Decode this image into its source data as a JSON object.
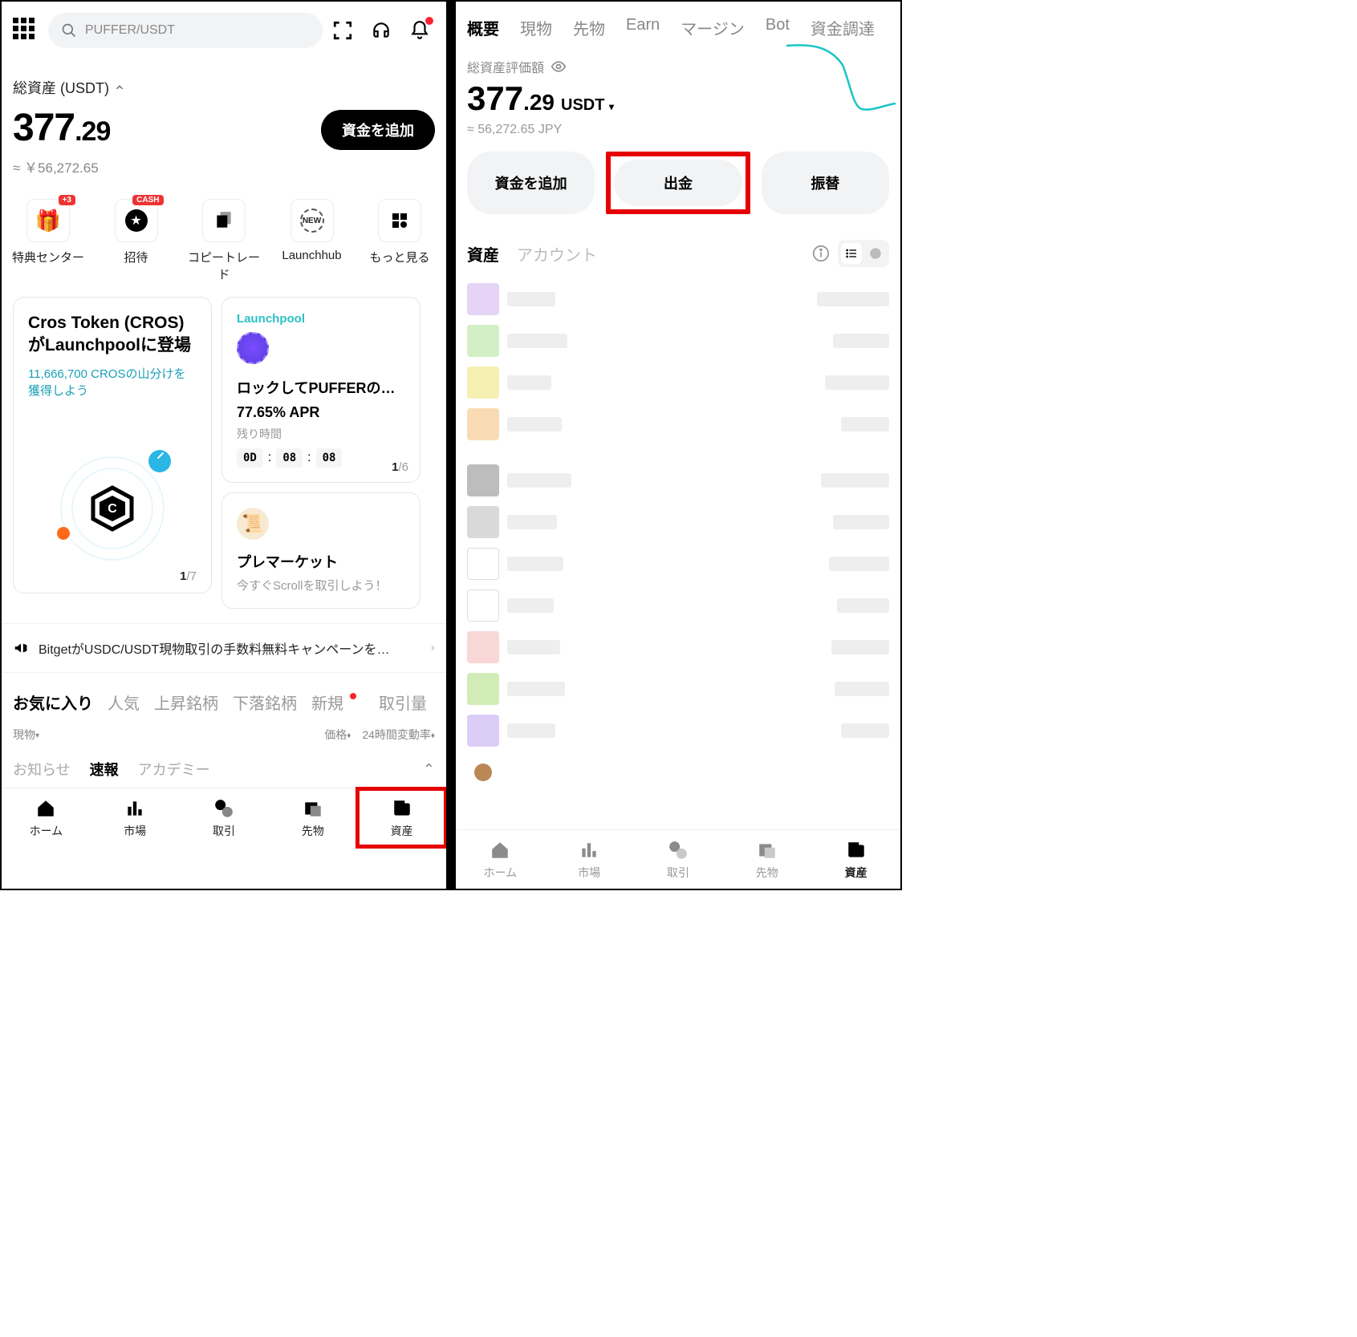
{
  "left": {
    "search_placeholder": "PUFFER/USDT",
    "total_label": "総資産 (USDT)",
    "amount_int": "377",
    "amount_dec": ".29",
    "approx": "≈ ￥56,272.65",
    "add_funds": "資金を追加",
    "quick": [
      {
        "label": "特典センター",
        "badge": "+3"
      },
      {
        "label": "招待",
        "badge": "CASH"
      },
      {
        "label": "コピートレード"
      },
      {
        "label": "Launchhub"
      },
      {
        "label": "もっと見る"
      }
    ],
    "promo": {
      "title": "Cros Token (CROS)がLaunchpoolに登場",
      "sub": "11,666,700 CROSの山分けを獲得しよう",
      "page_cur": "1",
      "page_tot": "/7"
    },
    "launchpool": {
      "tag": "Launchpool",
      "title": "ロックしてPUFFERのエア…",
      "apr": "77.65% APR",
      "remain": "残り時間",
      "d": "0D",
      "h": "08",
      "m": "08",
      "page_cur": "1",
      "page_tot": "/6"
    },
    "premarket": {
      "title": "プレマーケット",
      "sub": "今すぐScrollを取引しよう！"
    },
    "announce": "BitgetがUSDC/USDT現物取引の手数料無料キャンペーンを…",
    "fav_tabs": [
      "お気に入り",
      "人気",
      "上昇銘柄",
      "下落銘柄",
      "新規",
      "取引量"
    ],
    "cols": {
      "cat": "現物",
      "price": "価格",
      "change": "24時間変動率"
    },
    "news_tabs": [
      "お知らせ",
      "速報",
      "アカデミー"
    ],
    "nav": [
      "ホーム",
      "市場",
      "取引",
      "先物",
      "資産"
    ]
  },
  "right": {
    "tabs": [
      "概要",
      "現物",
      "先物",
      "Earn",
      "マージン",
      "Bot",
      "資金調達"
    ],
    "total_label": "総資産評価額",
    "amount_int": "377",
    "amount_dec": ".29",
    "unit": "USDT",
    "approx": "≈ 56,272.65 JPY",
    "actions": [
      "資金を追加",
      "出金",
      "振替"
    ],
    "sub_tabs": [
      "資産",
      "アカウント"
    ],
    "nav": [
      "ホーム",
      "市場",
      "取引",
      "先物",
      "資産"
    ]
  }
}
